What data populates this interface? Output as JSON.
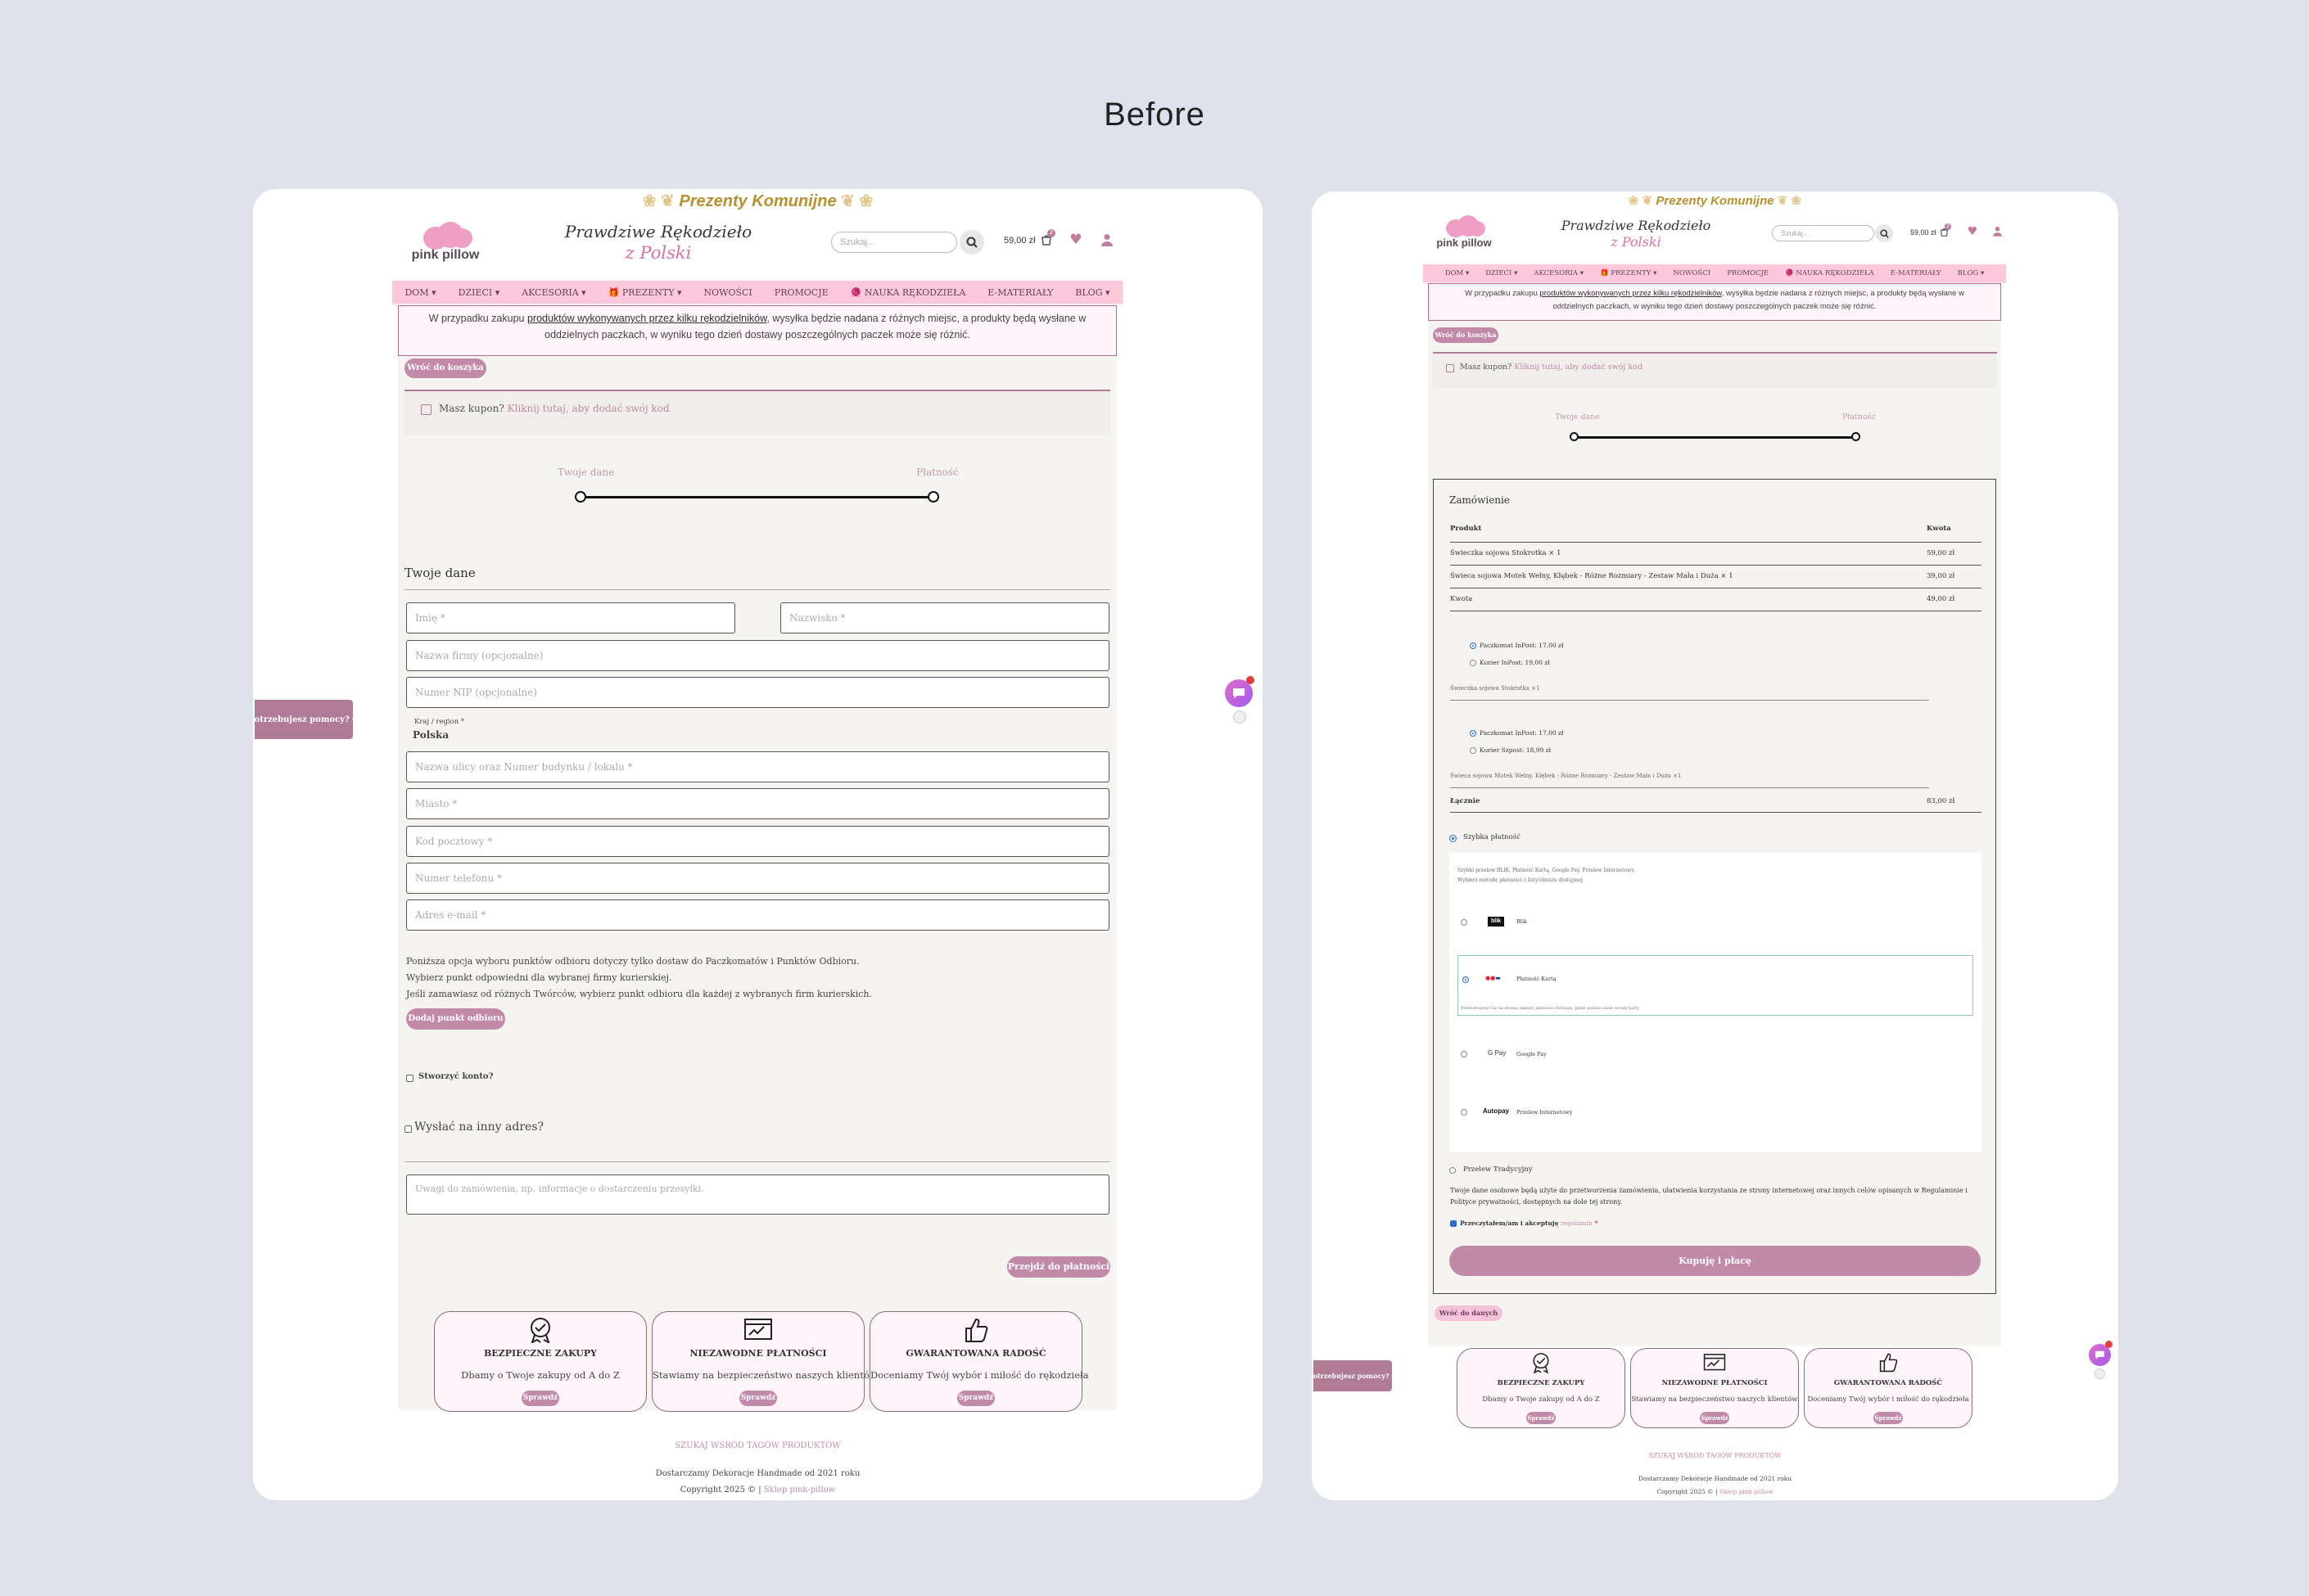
{
  "heading": "Before",
  "promo_banner": "Prezenty Komunijne",
  "logo_text": "pink pillow",
  "tagline": {
    "line1": "Prawdziwe Rękodzieło",
    "line2": "z Polski"
  },
  "search": {
    "placeholder": "Szukaj..."
  },
  "cart": {
    "amount": "59,00 zł",
    "count": "2"
  },
  "nav": [
    "DOM ▾",
    "DZIECI ▾",
    "AKCESORIA ▾",
    "🎁 PREZENTY ▾",
    "NOWOŚCI",
    "PROMOCJE",
    "🧶 NAUKA RĘKODZIEŁA",
    "E-MATERIAŁY",
    "BLOG ▾"
  ],
  "notice": {
    "before": "W przypadku zakupu ",
    "link": "produktów wykonywanych przez kilku rękodzielników",
    "after": ", wysyłka będzie nadana z różnych miejsc, a produkty będą wysłane w oddzielnych paczkach, w wyniku tego dzień dostawy poszczególnych paczek może się różnić."
  },
  "back_to_cart": "Wróć do koszyka",
  "coupon": {
    "label": "Masz kupon?",
    "link": "Kliknij tutaj, aby dodać swój kod"
  },
  "steps": [
    "Twoje dane",
    "Płatność"
  ],
  "form": {
    "title": "Twoje dane",
    "first_name": "Imię *",
    "last_name": "Nazwisko *",
    "company": "Nazwa firmy (opcjonalne)",
    "nip": "Numer NIP (opcjonalne)",
    "country_label": "Kraj / region *",
    "country_value": "Polska",
    "street": "Nazwa ulicy oraz Numer budynku / lokalu *",
    "city": "Miasto *",
    "postcode": "Kod pocztowy *",
    "phone": "Numer telefonu *",
    "email": "Adres e-mail *",
    "pickup_info": [
      "Poniższa opcja wyboru punktów odbioru dotyczy tylko dostaw do Paczkomatów i Punktów Odbioru.",
      "Wybierz punkt odpowiedni dla wybranej firmy kurierskiej.",
      "Jeśli zamawiasz od różnych Twórców, wybierz punkt odbioru dla każdej z wybranych firm kurierskich."
    ],
    "pickup_button": "Dodaj punkt odbioru",
    "create_account": "Stworzyć konto?",
    "ship_other": "Wysłać na inny adres?",
    "notes_placeholder": "Uwagi do zamówienia, np. informacje o dostarczeniu przesyłki.",
    "next_button": "Przejdź do płatności"
  },
  "features": [
    {
      "icon": "badge-check-icon",
      "title": "BEZPIECZNE ZAKUPY",
      "desc": "Dbamy o Twoje zakupy od A do Z",
      "button": "Sprawdź"
    },
    {
      "icon": "payment-icon",
      "title": "NIEZAWODNE PŁATNOŚCI",
      "desc": "Stawiamy na bezpieczeństwo naszych klientów",
      "button": "Sprawdź"
    },
    {
      "icon": "thumbs-up-icon",
      "title": "GWARANTOWANA RADOŚĆ",
      "desc": "Doceniamy Twój wybór i miłość do rękodzieła",
      "button": "Sprawdź"
    }
  ],
  "footer": {
    "tags_link": "SZUKAJ WŚRÓD TAGÓW PRODUKTÓW",
    "since": "Dostarczamy Dekoracje Handmade od 2021 roku",
    "copyright": "Copyright 2025 © |",
    "copyright_link": "Sklep pink-pillow"
  },
  "help_tab": "Potrzebujesz pomocy?",
  "order": {
    "title": "Zamówienie",
    "col_product": "Produkt",
    "col_amount": "Kwota",
    "rows": [
      {
        "name": "Świeczka sojowa Stokrotka × 1",
        "amount": "59,00 zł"
      },
      {
        "name": "Świeca sojowa Motek Wełny, Kłębek - Różne Rozmiary - Zestaw Mała i Duża × 1",
        "amount": "39,00 zł"
      }
    ],
    "subtotal_label": "Kwota",
    "subtotal": "49,00 zł",
    "shipping1": {
      "opt1": "Paczkomat InPost: 17,00 zł",
      "opt2": "Kurier InPost: 19,00 zł",
      "item": "Świeczka sojowa Stokrotka ×1"
    },
    "shipping2": {
      "opt1": "Paczkomat InPost: 17,00 zł",
      "opt2": "Kurier Szpost: 18,99 zł",
      "item": "Świeca sojowa Motek Wełny, Kłębek - Różne Rozmiary - Zestaw Mała i Duża ×1"
    },
    "total_label": "Łącznie",
    "total": "83,00 zł",
    "fast_payment": "Szybka płatność",
    "fast_desc1": "Szybki przelew BLIK, Płatność Kartą, Google Pay, Przelew Internetowy.",
    "fast_desc2": "Wybierz metodę płatności z listy/obrazu dostępnej",
    "methods": [
      {
        "logo": "blik",
        "name": "Blik"
      },
      {
        "logo": "cards",
        "name": "Płatność Kartą",
        "note": "Przekierujesz Cię na stronę zapłaty płatności Autopay, gdzie podasz dane swojej karty"
      },
      {
        "logo": "G Pay",
        "name": "Google Pay"
      },
      {
        "logo": "Autopay",
        "name": "Przelew Internetowy"
      }
    ],
    "traditional": "Przelew Tradycyjny",
    "privacy": "Twoje dane osobowe będą użyte do przetworzenia zamówienia, ułatwienia korzystania ze strony internetowej oraz innych celów opisanych w Regulaminie i Polityce prywatności, dostępnych na dole tej strony.",
    "terms_label": "Przeczytałem/am i akceptuję",
    "terms_link": "regulamin",
    "terms_star": "*",
    "buy_button": "Kupuję i płacę",
    "back_to_data": "Wróć do danych"
  },
  "colors": {
    "accent": "#c28aa9",
    "nav_bg": "#fcc9dc",
    "panel_bg": "#f6f4f0",
    "promo": "#b8902e"
  }
}
